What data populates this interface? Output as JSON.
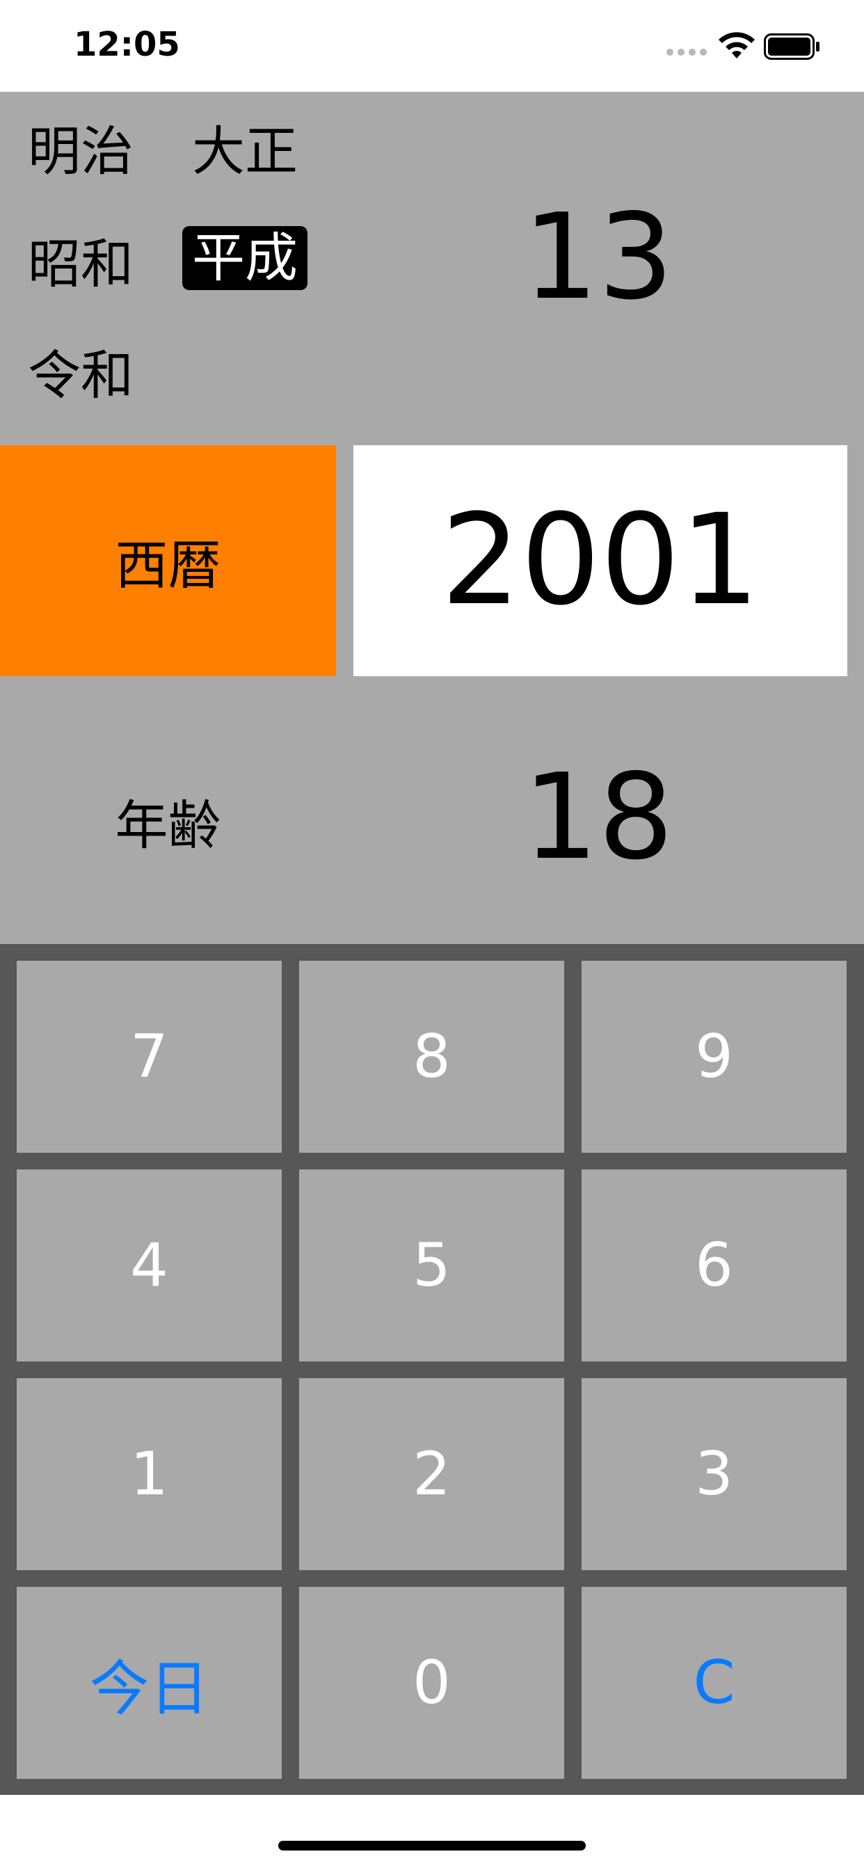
{
  "status_bar": {
    "time": "12:05"
  },
  "eras": [
    {
      "label": "明治",
      "selected": false
    },
    {
      "label": "大正",
      "selected": false
    },
    {
      "label": "昭和",
      "selected": false
    },
    {
      "label": "平成",
      "selected": true
    },
    {
      "label": "令和",
      "selected": false
    }
  ],
  "era_year": "13",
  "seireki": {
    "label": "西暦",
    "value": "2001"
  },
  "age": {
    "label": "年齢",
    "value": "18"
  },
  "keypad": {
    "keys": [
      "7",
      "8",
      "9",
      "4",
      "5",
      "6",
      "1",
      "2",
      "3",
      "今日",
      "0",
      "C"
    ]
  },
  "colors": {
    "accent_orange": "#ff7f00",
    "panel_gray": "#a9a9a9",
    "keypad_bg": "#575757",
    "action_blue": "#0a7aff"
  }
}
